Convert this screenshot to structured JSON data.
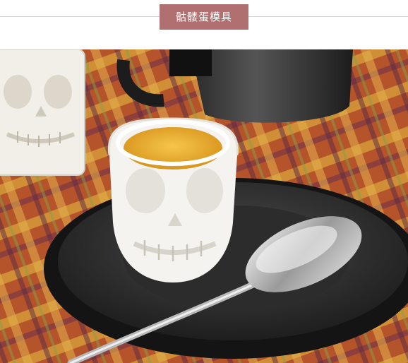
{
  "header": {
    "title": "骷髅蛋模具"
  },
  "photo": {
    "alt_icon": "skull-egg-cup-photo"
  },
  "colors": {
    "badge_bg": "#b07070",
    "badge_text": "#ffffff",
    "rule": "#d8d0d0"
  }
}
